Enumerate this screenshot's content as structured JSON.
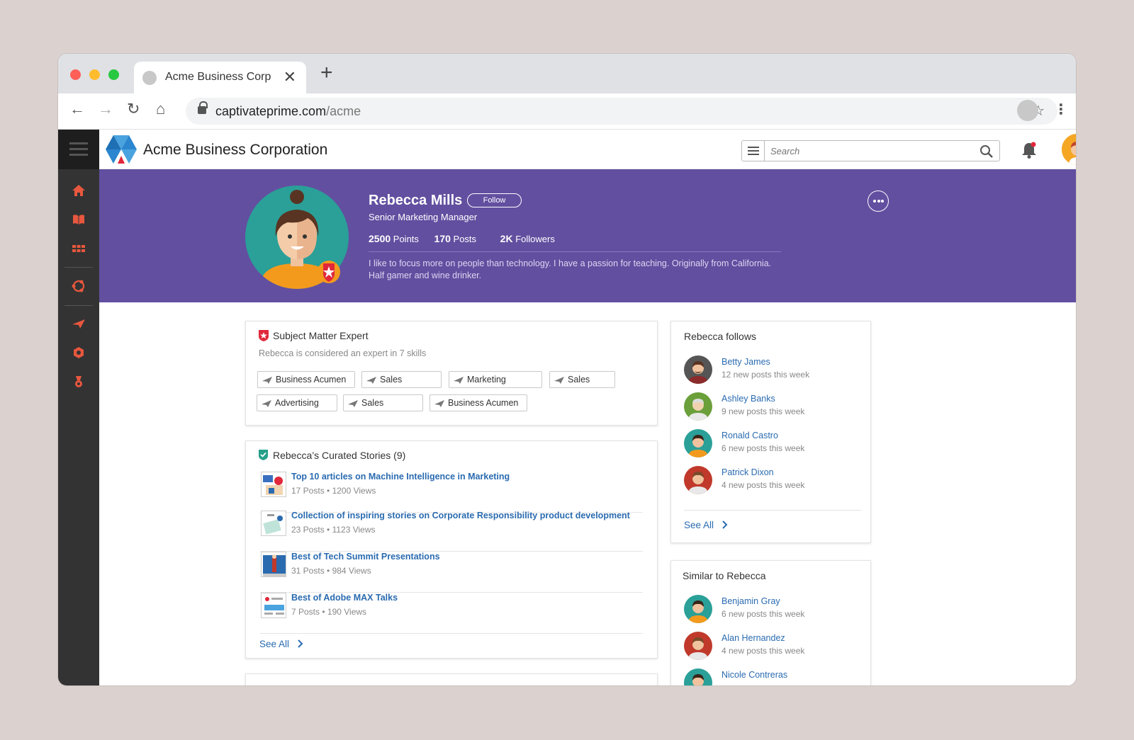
{
  "browser": {
    "tab_title": "Acme Business Corp",
    "tab_close": "✕",
    "new_tab": "+",
    "url_host": "captivateprime.com",
    "url_path": "/acme",
    "back": "←",
    "forward": "→",
    "reload": "↻",
    "home": "⌂",
    "star": "☆",
    "menu": "⋮"
  },
  "app": {
    "brand": "Acme Business Corporation",
    "search_placeholder": "Search",
    "sidebar_icons": [
      "home-icon",
      "book-icon",
      "grid-icon",
      "globe-icon",
      "paper-plane-icon",
      "badge-icon",
      "medal-icon"
    ]
  },
  "profile": {
    "name": "Rebecca Mills",
    "follow_label": "Follow",
    "title": "Senior Marketing Manager",
    "stats": [
      {
        "value": "2500",
        "label": "Points"
      },
      {
        "value": "170",
        "label": "Posts"
      },
      {
        "value": "2K",
        "label": "Followers"
      }
    ],
    "bio": "I like to focus more on people than technology. I have a passion for teaching. Originally from California. Half gamer and wine drinker."
  },
  "expert": {
    "title": "Subject Matter Expert",
    "subtitle": "Rebecca is considered an expert in 7 skills",
    "skills": [
      "Business Acumen",
      "Sales",
      "Marketing",
      "Sales",
      "Advertising",
      "Sales",
      "Business Acumen"
    ]
  },
  "stories": {
    "title": "Rebecca’s Curated Stories (9)",
    "items": [
      {
        "title": "Top 10 articles on Machine Intelligence in Marketing",
        "meta": "17 Posts • 1200 Views"
      },
      {
        "title": "Collection of inspiring stories on Corporate Responsibility product development",
        "meta": "23 Posts • 1123 Views"
      },
      {
        "title": "Best of Tech Summit Presentations",
        "meta": "31 Posts • 984 Views"
      },
      {
        "title": "Best of Adobe MAX Talks",
        "meta": "7 Posts • 190 Views"
      }
    ],
    "see_all": "See All"
  },
  "follows": {
    "title": "Rebecca follows",
    "people": [
      {
        "name": "Betty James",
        "sub": "12 new posts this week"
      },
      {
        "name": "Ashley Banks",
        "sub": "9 new posts this week"
      },
      {
        "name": "Ronald Castro",
        "sub": "6 new posts this week"
      },
      {
        "name": "Patrick Dixon",
        "sub": "4 new posts this week"
      }
    ],
    "see_all": "See All"
  },
  "similar": {
    "title": "Similar to Rebecca",
    "people": [
      {
        "name": "Benjamin Gray",
        "sub": "6 new posts this week"
      },
      {
        "name": "Alan Hernandez",
        "sub": "4 new posts this week"
      },
      {
        "name": "Nicole Contreras",
        "sub": ""
      }
    ]
  },
  "colors": {
    "hero": "#624fa0",
    "accent": "#e8573e",
    "link": "#2a6bb0",
    "sidebar": "#333333"
  }
}
